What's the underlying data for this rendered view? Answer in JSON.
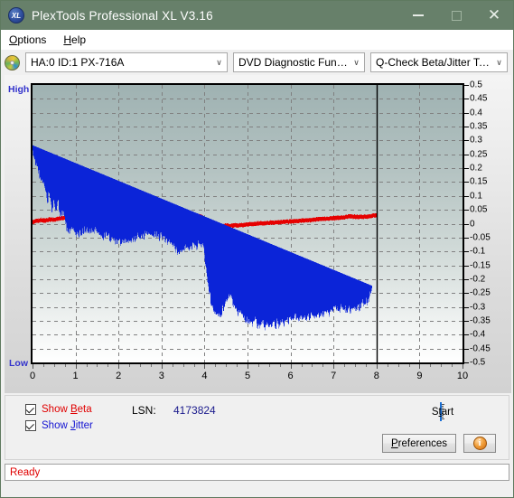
{
  "window": {
    "title": "PlexTools Professional XL V3.16",
    "app_icon": "XL",
    "minimize": "—",
    "maximize": "",
    "close": "✕",
    "accent_titlebar": "#67806a"
  },
  "menubar": {
    "items": [
      {
        "label": "Options",
        "mnemonic": "O"
      },
      {
        "label": "Help",
        "mnemonic": "H"
      }
    ]
  },
  "toolbar": {
    "drive_select": {
      "value": "HA:0 ID:1  PX-716A",
      "chevron": "∨"
    },
    "function_select": {
      "value": "DVD Diagnostic Functions",
      "chevron": "∨"
    },
    "test_select": {
      "value": "Q-Check Beta/Jitter Test",
      "chevron": "∨"
    }
  },
  "controls": {
    "show_beta": {
      "label_pre": "Show ",
      "label_mnemonic": "B",
      "label_post": "eta",
      "checked": true,
      "color": "#e00000"
    },
    "show_jitter": {
      "label_pre": "Show ",
      "label_mnemonic": "J",
      "label_post": "itter",
      "checked": true,
      "color": "#1414d2"
    },
    "lsn_label": "LSN:",
    "lsn_value": "4173824",
    "start_button": {
      "pre": "S",
      "mnemonic": "t",
      "post": "art",
      "full": "Start"
    },
    "preferences_button": {
      "pre": "",
      "mnemonic": "P",
      "post": "references",
      "full": "Preferences"
    },
    "info_button": {
      "glyph": "i"
    }
  },
  "statusbar": {
    "text": "Ready"
  },
  "chart_data": {
    "type": "line",
    "title": "",
    "xlabel": "",
    "ylabel": "",
    "xlim": [
      0,
      10
    ],
    "ylim": [
      -0.5,
      0.5
    ],
    "grid": true,
    "y_left_labels": {
      "high": "High",
      "low": "Low"
    },
    "y_ticks": [
      0.5,
      0.45,
      0.4,
      0.35,
      0.3,
      0.25,
      0.2,
      0.15,
      0.1,
      0.05,
      0,
      -0.05,
      -0.1,
      -0.15,
      -0.2,
      -0.25,
      -0.3,
      -0.35,
      -0.4,
      -0.45,
      -0.5
    ],
    "y_tick_labels": [
      "0.5",
      "0.45",
      "0.4",
      "0.35",
      "0.3",
      "0.25",
      "0.2",
      "0.15",
      "0.1",
      "0.05",
      "0",
      "-0.05",
      "-0.1",
      "-0.15",
      "-0.2",
      "-0.25",
      "-0.3",
      "-0.35",
      "-0.4",
      "-0.45",
      "-0.5"
    ],
    "x_ticks": [
      0,
      1,
      2,
      3,
      4,
      5,
      6,
      7,
      8,
      9,
      10
    ],
    "x_tick_labels": [
      "0",
      "1",
      "2",
      "3",
      "4",
      "5",
      "6",
      "7",
      "8",
      "9",
      "10"
    ],
    "data_end_marker_x": 8,
    "series": [
      {
        "name": "Beta",
        "color": "#e60000",
        "x": [
          0.0,
          0.1,
          0.2,
          0.3,
          0.4,
          0.5,
          0.6,
          0.7,
          0.8,
          0.9,
          1.0,
          1.2,
          1.4,
          1.6,
          1.8,
          2.0,
          2.2,
          2.4,
          2.6,
          2.8,
          3.0,
          3.2,
          3.4,
          3.6,
          3.8,
          3.95,
          4.02,
          4.1,
          4.25,
          4.4,
          4.5,
          4.6,
          4.8,
          5.0,
          5.2,
          5.4,
          5.6,
          5.8,
          6.0,
          6.2,
          6.4,
          6.6,
          6.8,
          7.0,
          7.2,
          7.4,
          7.6,
          7.8,
          7.95
        ],
        "values": [
          0.005,
          0.01,
          0.013,
          0.01,
          0.016,
          0.014,
          0.018,
          0.02,
          0.022,
          0.02,
          0.022,
          0.024,
          0.022,
          0.026,
          0.025,
          0.028,
          0.03,
          0.034,
          0.036,
          0.032,
          0.03,
          0.032,
          0.034,
          0.033,
          0.03,
          0.024,
          -0.012,
          -0.02,
          -0.018,
          -0.01,
          -0.006,
          -0.008,
          -0.005,
          -0.003,
          0.0,
          0.002,
          0.004,
          0.006,
          0.008,
          0.01,
          0.012,
          0.015,
          0.018,
          0.02,
          0.022,
          0.026,
          0.024,
          0.026,
          0.03
        ]
      },
      {
        "name": "Jitter",
        "color": "#0b24d8",
        "x": [
          0.0,
          0.05,
          0.1,
          0.15,
          0.2,
          0.25,
          0.3,
          0.35,
          0.4,
          0.45,
          0.5,
          0.55,
          0.6,
          0.65,
          0.7,
          0.8,
          0.9,
          1.0,
          1.1,
          1.2,
          1.3,
          1.4,
          1.5,
          1.6,
          1.7,
          1.8,
          1.9,
          2.0,
          2.1,
          2.2,
          2.3,
          2.4,
          2.5,
          2.6,
          2.7,
          2.8,
          2.9,
          3.0,
          3.1,
          3.2,
          3.3,
          3.4,
          3.5,
          3.6,
          3.7,
          3.8,
          3.9,
          3.97,
          4.02,
          4.08,
          4.15,
          4.22,
          4.3,
          4.4,
          4.5,
          4.6,
          4.7,
          4.8,
          4.9,
          5.0,
          5.1,
          5.2,
          5.3,
          5.4,
          5.5,
          5.6,
          5.7,
          5.8,
          5.9,
          6.0,
          6.1,
          6.2,
          6.3,
          6.4,
          6.5,
          6.6,
          6.7,
          6.8,
          6.9,
          7.0,
          7.1,
          7.2,
          7.3,
          7.4,
          7.5,
          7.6,
          7.7,
          7.8,
          7.9,
          7.97
        ],
        "values": [
          0.245,
          0.205,
          0.175,
          0.15,
          0.125,
          0.12,
          0.09,
          0.06,
          0.085,
          0.02,
          0.045,
          0.015,
          0.06,
          -0.005,
          0.025,
          -0.04,
          -0.055,
          -0.06,
          -0.065,
          -0.05,
          -0.048,
          -0.052,
          -0.06,
          -0.07,
          -0.075,
          -0.08,
          -0.085,
          -0.09,
          -0.092,
          -0.095,
          -0.09,
          -0.088,
          -0.085,
          -0.075,
          -0.07,
          -0.065,
          -0.07,
          -0.075,
          -0.085,
          -0.1,
          -0.115,
          -0.13,
          -0.125,
          -0.12,
          -0.115,
          -0.105,
          -0.11,
          -0.105,
          -0.17,
          -0.25,
          -0.31,
          -0.345,
          -0.37,
          -0.35,
          -0.3,
          -0.285,
          -0.33,
          -0.355,
          -0.365,
          -0.375,
          -0.38,
          -0.385,
          -0.39,
          -0.395,
          -0.39,
          -0.392,
          -0.388,
          -0.385,
          -0.38,
          -0.375,
          -0.372,
          -0.37,
          -0.368,
          -0.365,
          -0.362,
          -0.358,
          -0.352,
          -0.348,
          -0.35,
          -0.345,
          -0.34,
          -0.342,
          -0.338,
          -0.335,
          -0.332,
          -0.33,
          -0.32,
          -0.305,
          -0.27
        ]
      }
    ]
  }
}
